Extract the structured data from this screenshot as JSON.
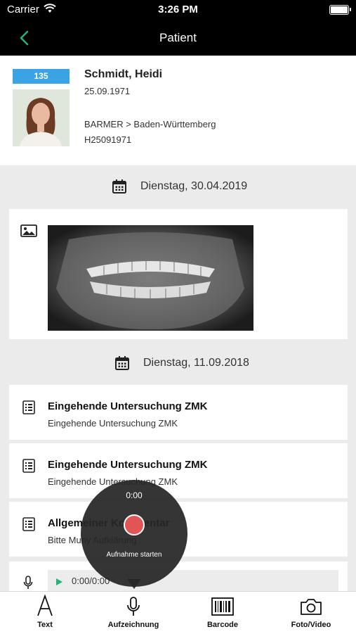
{
  "status_bar": {
    "carrier": "Carrier",
    "time": "3:26 PM"
  },
  "nav": {
    "title": "Patient",
    "back_icon": "chevron-left-icon",
    "accent": "#22b573"
  },
  "patient": {
    "id": "135",
    "name": "Schmidt, Heidi",
    "dob": "25.09.1971",
    "insurance": "BARMER > Baden-Württemberg",
    "insurance_number": "H25091971",
    "badge_color": "#3aa3e3"
  },
  "timeline": {
    "date1": "Dienstag, 30.04.2019",
    "date2": "Dienstag, 11.09.2018",
    "entries": [
      {
        "title": "Eingehende Untersuchung ZMK",
        "subtitle": "Eingehende Untersuchung ZMK"
      },
      {
        "title": "Eingehende Untersuchung ZMK",
        "subtitle": "Eingehende Untersuchung ZMK"
      },
      {
        "title": "Allgemeiner Kommentar",
        "subtitle": "Bitte Muhy Aufklärung"
      }
    ],
    "audio": {
      "time": "0:00/0:00"
    }
  },
  "recorder": {
    "time": "0:00",
    "label": "Aufnahme starten",
    "button_color": "#e35456"
  },
  "tabs": [
    {
      "label": "Text",
      "icon": "text-icon"
    },
    {
      "label": "Aufzeichnung",
      "icon": "microphone-icon"
    },
    {
      "label": "Barcode",
      "icon": "barcode-icon"
    },
    {
      "label": "Foto/Video",
      "icon": "camera-icon"
    }
  ]
}
